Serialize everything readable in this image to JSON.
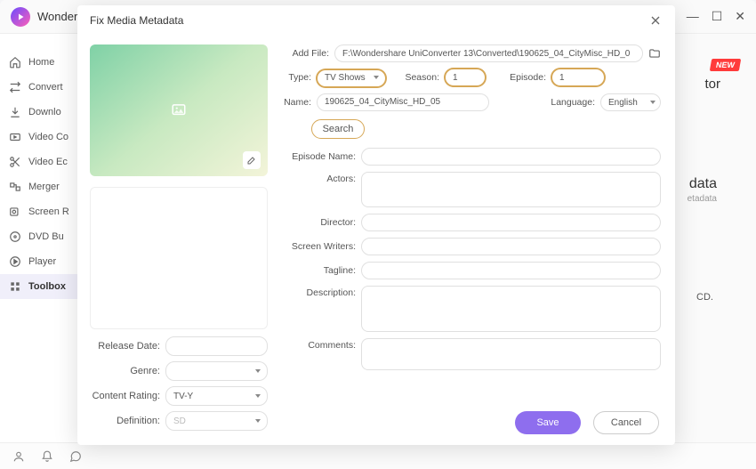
{
  "app_title": "Wonder",
  "sidebar": {
    "items": [
      {
        "label": "Home",
        "icon": "home"
      },
      {
        "label": "Convert",
        "icon": "convert"
      },
      {
        "label": "Downlo",
        "icon": "download"
      },
      {
        "label": "Video Co",
        "icon": "compress"
      },
      {
        "label": "Video Ec",
        "icon": "scissors"
      },
      {
        "label": "Merger",
        "icon": "merge"
      },
      {
        "label": "Screen R",
        "icon": "record"
      },
      {
        "label": "DVD Bu",
        "icon": "disc"
      },
      {
        "label": "Player",
        "icon": "play"
      },
      {
        "label": "Toolbox",
        "icon": "grid"
      }
    ]
  },
  "badge_new": "NEW",
  "partial": {
    "tor": "tor",
    "data": "data",
    "etadata": "etadata",
    "cd": "CD."
  },
  "modal": {
    "title": "Fix Media Metadata",
    "add_file": {
      "label": "Add File:",
      "value": "F:\\Wondershare UniConverter 13\\Converted\\190625_04_CityMisc_HD_0"
    },
    "type": {
      "label": "Type:",
      "value": "TV Shows"
    },
    "season": {
      "label": "Season:",
      "value": "1"
    },
    "episode": {
      "label": "Episode:",
      "value": "1"
    },
    "name": {
      "label": "Name:",
      "value": "190625_04_CityMisc_HD_05"
    },
    "language": {
      "label": "Language:",
      "value": "English"
    },
    "search_btn": "Search",
    "episode_name": {
      "label": "Episode Name:"
    },
    "actors": {
      "label": "Actors:"
    },
    "director": {
      "label": "Director:"
    },
    "screen_writers": {
      "label": "Screen Writers:"
    },
    "tagline": {
      "label": "Tagline:"
    },
    "description": {
      "label": "Description:"
    },
    "comments": {
      "label": "Comments:"
    },
    "left_form": {
      "release_date": {
        "label": "Release Date:"
      },
      "genre": {
        "label": "Genre:"
      },
      "content_rating": {
        "label": "Content Rating:",
        "value": "TV-Y"
      },
      "definition": {
        "label": "Definition:",
        "value": "SD"
      }
    },
    "buttons": {
      "save": "Save",
      "cancel": "Cancel"
    }
  }
}
